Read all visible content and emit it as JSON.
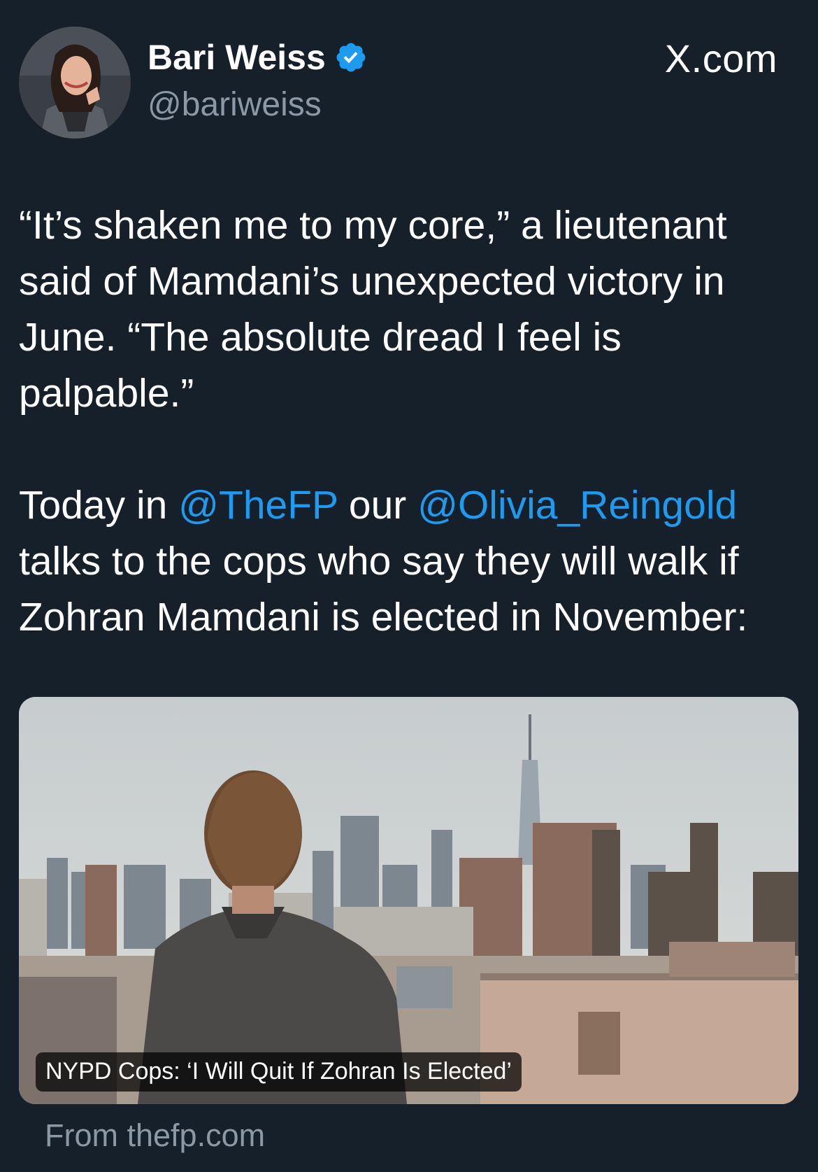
{
  "author": {
    "display_name": "Bari Weiss",
    "handle": "@bariweiss",
    "verified": true,
    "avatar_icon": "profile-photo"
  },
  "site_label": "X.com",
  "tweet": {
    "paragraph1": "“It’s shaken me to my core,” a lieutenant said of Mamdani’s unexpected victory in June. “The absolute dread I feel is palpable.”",
    "paragraph2": {
      "part1": "Today in ",
      "mention1": "@TheFP",
      "part2": " our ",
      "mention2": "@Olivia_Reingold",
      "part3": " talks to the cops who say they will walk if Zohran Mamdani is elected in November:"
    }
  },
  "link_card": {
    "caption": "NYPD Cops: ‘I Will Quit If Zohran Is Elected’",
    "source": "From thefp.com"
  },
  "colors": {
    "background": "#15202b",
    "text": "#ffffff",
    "muted": "#8b98a5",
    "link": "#1d9bf0",
    "verified_badge": "#1d9bf0"
  }
}
